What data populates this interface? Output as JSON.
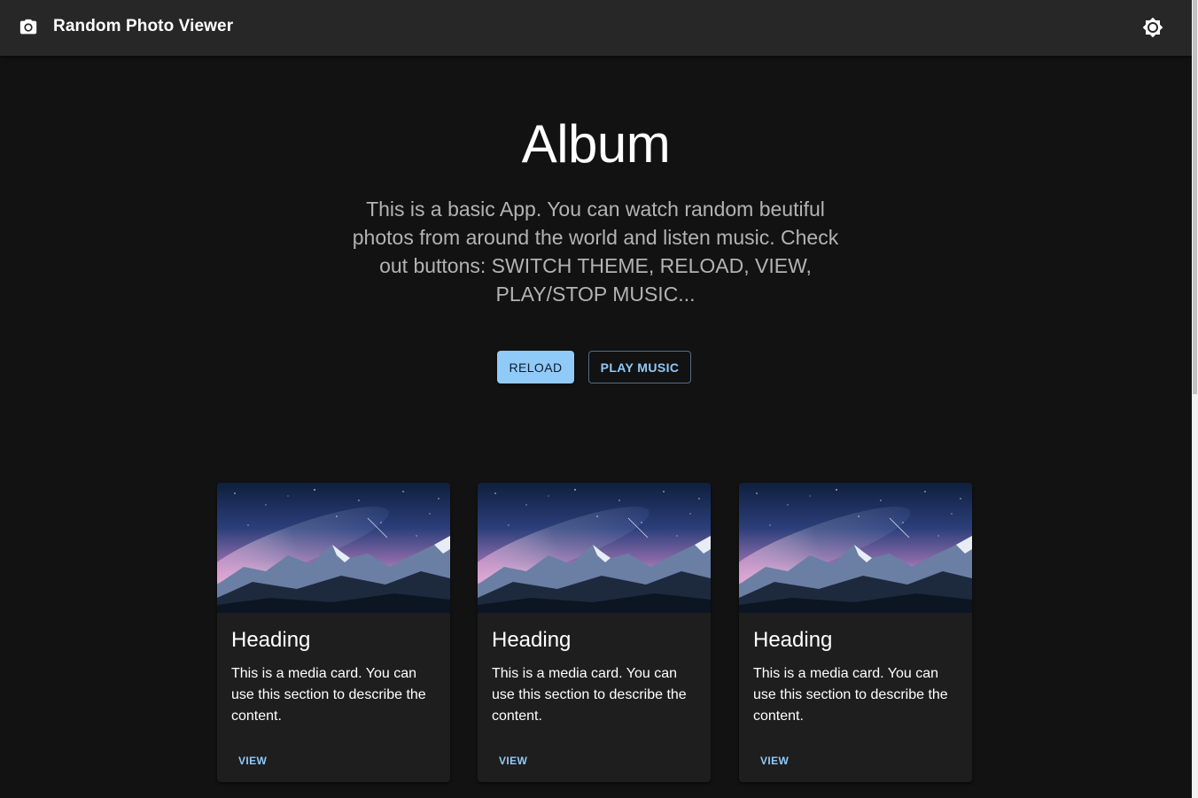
{
  "appbar": {
    "title": "Random Photo Viewer",
    "left_icon": "camera-icon",
    "right_icon": "brightness-icon"
  },
  "hero": {
    "title": "Album",
    "description": "This is a basic App. You can watch random beutiful photos from around the world and listen music. Check out buttons: SWITCH THEME, RELOAD, VIEW, PLAY/STOP MUSIC...",
    "reload_label": "RELOAD",
    "music_label": "PLAY MUSIC"
  },
  "cards": [
    {
      "heading": "Heading",
      "body": "This is a media card. You can use this section to describe the content.",
      "view_label": "VIEW"
    },
    {
      "heading": "Heading",
      "body": "This is a media card. You can use this section to describe the content.",
      "view_label": "VIEW"
    },
    {
      "heading": "Heading",
      "body": "This is a media card. You can use this section to describe the content.",
      "view_label": "VIEW"
    }
  ],
  "colors": {
    "background": "#121212",
    "appbar": "#272727",
    "card": "#1e1e1e",
    "accent": "#90caf9"
  }
}
